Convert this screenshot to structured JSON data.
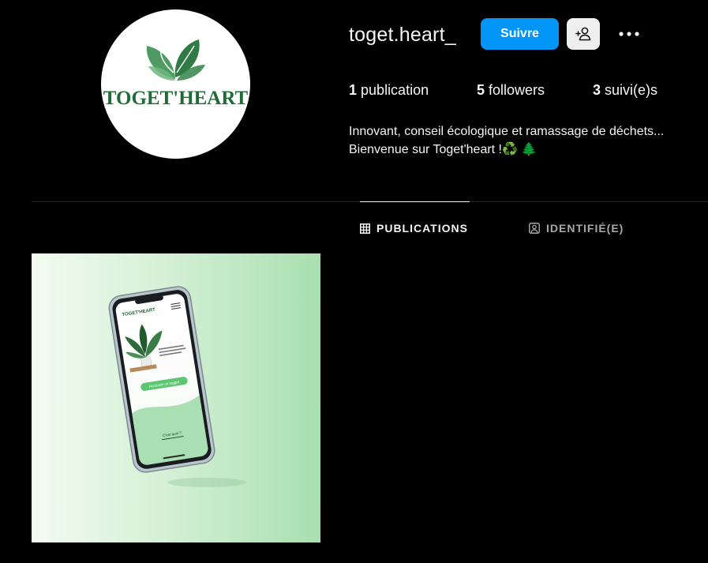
{
  "profile": {
    "username": "toget.heart_",
    "avatar_text": "TOGET'HEART",
    "follow_label": "Suivre",
    "add_friend_icon": "add-person-icon",
    "more_icon": "more-horizontal-icon"
  },
  "stats": {
    "posts_count": "1",
    "posts_label": "publication",
    "followers_count": "5",
    "followers_label": "followers",
    "following_count": "3",
    "following_label": "suivi(e)s"
  },
  "bio": {
    "line1": "Innovant, conseil écologique et ramassage de déchets...",
    "line2": "Bienvenue sur Toget'heart !♻️ 🌲"
  },
  "tabs": [
    {
      "label": "PUBLICATIONS",
      "icon": "grid-icon",
      "active": true
    },
    {
      "label": "IDENTIFIÉ(E)",
      "icon": "tagged-icon",
      "active": false
    }
  ],
  "post": {
    "phone_brand": "TOGET'HEART",
    "cta_label": "Recevoir un togget",
    "link_label": "C'est quoi ?"
  },
  "colors": {
    "background": "#000000",
    "accent": "#0095f6",
    "brand_green": "#1e6b34",
    "text_primary": "#f5f5f5",
    "text_secondary": "#a8a8a8"
  }
}
